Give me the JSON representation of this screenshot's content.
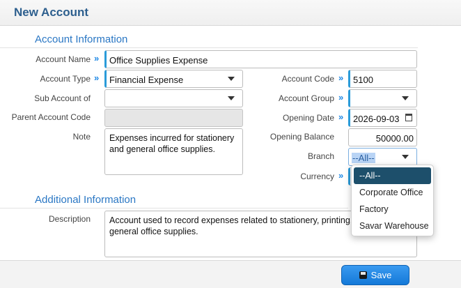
{
  "window": {
    "title": "New Account"
  },
  "sections": {
    "account_info": "Account Information",
    "additional_info": "Additional Information"
  },
  "fields": {
    "account_name": {
      "label": "Account Name",
      "value": "Office Supplies Expense"
    },
    "account_type": {
      "label": "Account Type",
      "value": "Financial Expense"
    },
    "sub_account_of": {
      "label": "Sub Account of",
      "value": ""
    },
    "parent_account_code": {
      "label": "Parent Account Code",
      "value": ""
    },
    "note": {
      "label": "Note",
      "value": "Expenses incurred for stationery and general office supplies."
    },
    "account_code": {
      "label": "Account Code",
      "value": "5100"
    },
    "account_group": {
      "label": "Account Group",
      "value": ""
    },
    "opening_date": {
      "label": "Opening Date",
      "value": "2026-09-03"
    },
    "opening_balance": {
      "label": "Opening Balance",
      "value": "50000.00"
    },
    "branch": {
      "label": "Branch",
      "value": "--All--"
    },
    "currency": {
      "label": "Currency",
      "value": ""
    },
    "description": {
      "label": "Description",
      "value": "Account used to record expenses related to stationery, printing, and other general office supplies."
    }
  },
  "branch_dropdown": {
    "options": [
      "--All--",
      "Corporate Office",
      "Factory",
      "Savar Warehouse"
    ],
    "selected": "--All--"
  },
  "icons": {
    "required_marker": "»",
    "save_icon": "floppy-disk-icon",
    "calendar_icon": "calendar-icon"
  },
  "buttons": {
    "save": "Save"
  },
  "colors": {
    "accent": "#2a9bd9",
    "title": "#2d5f8e",
    "selected_option": "#1d4f6b",
    "save_button": "#1f86e6"
  }
}
